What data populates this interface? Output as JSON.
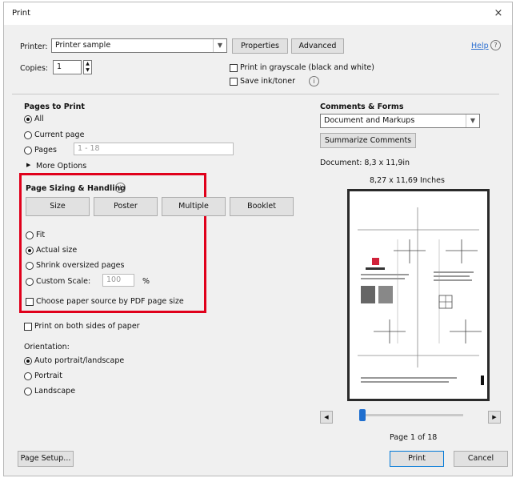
{
  "window": {
    "title": "Print",
    "close_icon": "×"
  },
  "top": {
    "printer_label": "Printer:",
    "printer_value": "Printer sample",
    "properties_label": "Properties",
    "advanced_label": "Advanced",
    "help_label": "Help",
    "copies_label": "Copies:",
    "copies_value": "1",
    "grayscale_label": "Print in grayscale (black and white)",
    "save_ink_label": "Save ink/toner"
  },
  "pages_to_print": {
    "heading": "Pages to Print",
    "all_label": "All",
    "current_label": "Current page",
    "pages_label": "Pages",
    "pages_value": "1 - 18",
    "more_options_label": "More Options",
    "selected": "all"
  },
  "sizing": {
    "heading": "Page Sizing & Handling",
    "tabs": [
      "Size",
      "Poster",
      "Multiple",
      "Booklet"
    ],
    "fit_label": "Fit",
    "actual_label": "Actual size",
    "shrink_label": "Shrink oversized pages",
    "custom_label": "Custom Scale:",
    "custom_value": "100",
    "percent": "%",
    "paper_source_label": "Choose paper source by PDF page size",
    "selected": "actual",
    "highlight_color": "#e0001b"
  },
  "duplex": {
    "label": "Print on both sides of paper"
  },
  "orientation": {
    "heading": "Orientation:",
    "auto_label": "Auto portrait/landscape",
    "portrait_label": "Portrait",
    "landscape_label": "Landscape",
    "selected": "auto"
  },
  "comments": {
    "heading": "Comments & Forms",
    "value": "Document and Markups",
    "summarize_label": "Summarize Comments"
  },
  "preview": {
    "document_label": "Document: 8,3 x 11,9in",
    "size_label": "8,27 x 11,69 Inches",
    "page_label": "Page 1 of 18",
    "page_fraction": 0.0
  },
  "bottom": {
    "page_setup_label": "Page Setup...",
    "print_label": "Print",
    "cancel_label": "Cancel"
  },
  "colors": {
    "accent": "#1f6fcf",
    "dialog_bg": "#f0f0f0"
  }
}
